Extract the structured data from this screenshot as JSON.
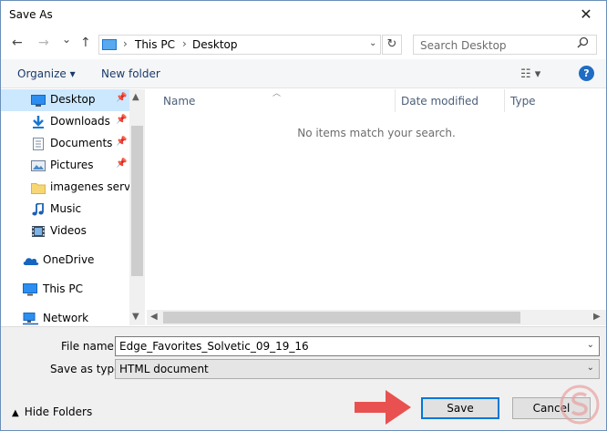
{
  "window": {
    "title": "Save As",
    "close_glyph": "✕"
  },
  "nav": {
    "back_glyph": "←",
    "forward_glyph": "→",
    "recent_glyph": "⌄",
    "up_glyph": "↑",
    "address": {
      "crumbs": [
        "This PC",
        "Desktop"
      ],
      "icon": "this-pc-icon"
    },
    "refresh_glyph": "↻",
    "search_placeholder": "Search Desktop",
    "search_icon_glyph": "⚲"
  },
  "command_bar": {
    "organize": "Organize ▾",
    "new_folder": "New folder",
    "view_glyph": "☷ ▾",
    "help_glyph": "?"
  },
  "sidebar": {
    "items": [
      {
        "label": "Desktop",
        "icon": "desktop-icon",
        "pinned": true,
        "selected": true
      },
      {
        "label": "Downloads",
        "icon": "downloads-icon",
        "pinned": true
      },
      {
        "label": "Documents",
        "icon": "documents-icon",
        "pinned": true
      },
      {
        "label": "Pictures",
        "icon": "pictures-icon",
        "pinned": true
      },
      {
        "label": "imagenes server",
        "icon": "folder-icon",
        "pinned": false
      },
      {
        "label": "Music",
        "icon": "music-icon",
        "pinned": false
      },
      {
        "label": "Videos",
        "icon": "videos-icon",
        "pinned": false
      },
      {
        "label": "OneDrive",
        "icon": "onedrive-icon",
        "pinned": false
      },
      {
        "label": "This PC",
        "icon": "this-pc-icon",
        "pinned": false
      },
      {
        "label": "Network",
        "icon": "network-icon",
        "pinned": false
      }
    ],
    "pin_glyph": "📌"
  },
  "file_list": {
    "columns": [
      "Name",
      "Date modified",
      "Type"
    ],
    "empty_message": "No items match your search."
  },
  "form": {
    "file_name_label": "File name:",
    "file_name_value": "Edge_Favorites_Solvetic_09_19_16",
    "save_type_label": "Save as type:",
    "save_type_value": "HTML document"
  },
  "footer": {
    "hide_folders": "Hide Folders",
    "save": "Save",
    "cancel": "Cancel"
  },
  "colors": {
    "selection": "#cce8ff",
    "accent": "#0078d7",
    "arrow": "#e8514f"
  }
}
